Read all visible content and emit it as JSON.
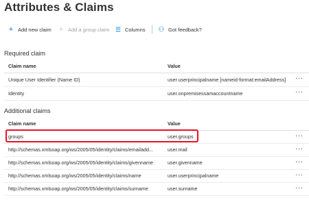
{
  "header": {
    "title": "Attributes & Claims",
    "more": "···"
  },
  "toolbar": {
    "add_new_claim": "Add new claim",
    "add_group_claim": "Add a group claim",
    "columns": "Columns",
    "feedback": "Got feedback?"
  },
  "required": {
    "title": "Required claim",
    "col_name": "Claim name",
    "col_value": "Value",
    "rows": [
      {
        "name": "Unique User Identifier (Name ID)",
        "value": "user.userprincipalname [nameid-format:emailAddress]"
      },
      {
        "name": "Identity",
        "value": "user.onpremisessamaccountname"
      }
    ]
  },
  "additional": {
    "title": "Additional claims",
    "col_name": "Claim name",
    "col_value": "Value",
    "rows": [
      {
        "name": "groups",
        "value": "user.groups"
      },
      {
        "name": "http://schemas.xmlsoap.org/ws/2005/05/identity/claims/emailadd...",
        "value": "user.mail"
      },
      {
        "name": "http://schemas.xmlsoap.org/ws/2005/05/identity/claims/givenname",
        "value": "user.givenname"
      },
      {
        "name": "http://schemas.xmlsoap.org/ws/2005/05/identity/claims/name",
        "value": "user.userprincipalname"
      },
      {
        "name": "http://schemas.xmlsoap.org/ws/2005/05/identity/claims/surname",
        "value": "user.surname"
      }
    ]
  },
  "row_more": "···",
  "colors": {
    "accent": "#0078d4",
    "highlight": "#e81123"
  }
}
